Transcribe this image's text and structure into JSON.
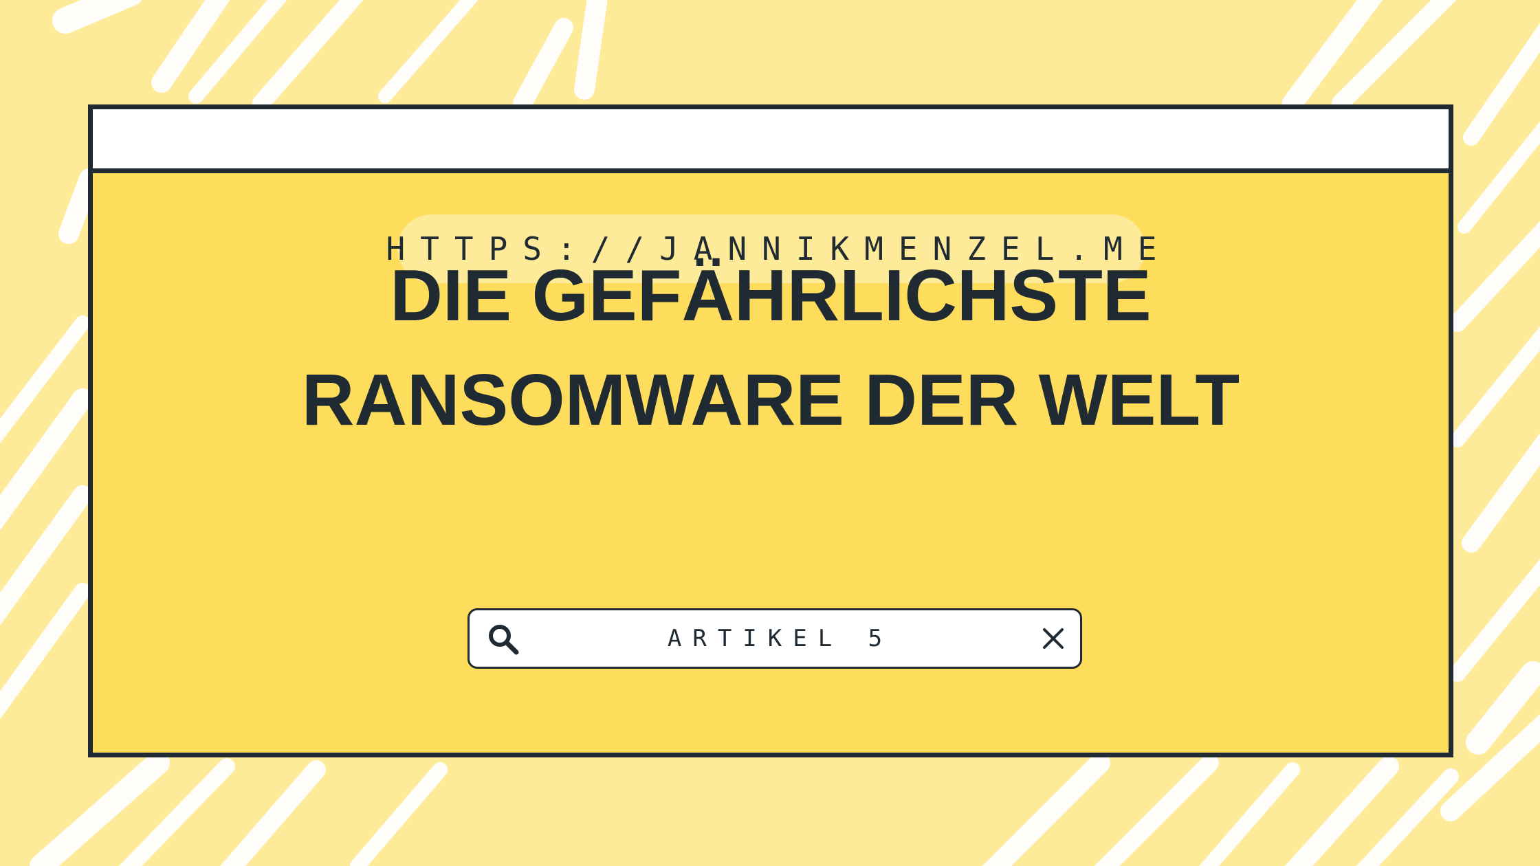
{
  "window": {
    "url": "HTTPS://JANNIKMENZEL.ME",
    "headline_line1": "DIE GEFÄHRLICHSTE",
    "headline_line2": "RANSOMWARE DER WELT"
  },
  "search": {
    "value": "ARTIKEL 5",
    "search_icon": "search-icon",
    "close_icon": "close-icon"
  },
  "colors": {
    "background": "#fdeb9a",
    "window_fill": "#fedd5c",
    "border": "#1f2a33",
    "text": "#1f2a33",
    "white": "#ffffff"
  }
}
